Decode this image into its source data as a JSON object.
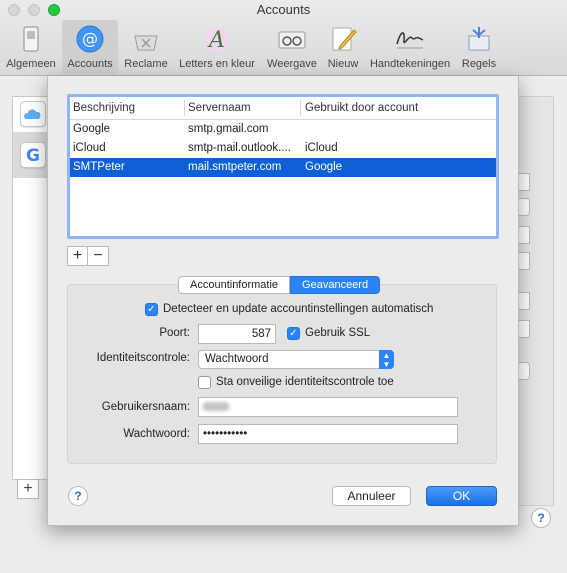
{
  "window": {
    "title": "Accounts"
  },
  "toolbar": {
    "items": [
      {
        "label": "Algemeen",
        "icon": "switch-icon"
      },
      {
        "label": "Accounts",
        "icon": "at-icon"
      },
      {
        "label": "Reclame",
        "icon": "junk-tray-icon"
      },
      {
        "label": "Letters en kleur",
        "icon": "font-color-icon"
      },
      {
        "label": "Weergave",
        "icon": "glasses-icon"
      },
      {
        "label": "Nieuw",
        "icon": "pencil-icon"
      },
      {
        "label": "Handtekeningen",
        "icon": "signature-icon"
      },
      {
        "label": "Regels",
        "icon": "rules-icon"
      }
    ],
    "active_index": 1
  },
  "smtp_table": {
    "columns": [
      "Beschrijving",
      "Servernaam",
      "Gebruikt door account"
    ],
    "rows": [
      {
        "description": "Google",
        "server": "smtp.gmail.com",
        "used_by": ""
      },
      {
        "description": "iCloud",
        "server": "smtp-mail.outlook....",
        "used_by": "iCloud"
      },
      {
        "description": "SMTPeter",
        "server": "mail.smtpeter.com",
        "used_by": "Google"
      }
    ],
    "selected_index": 2
  },
  "add_remove": {
    "add": "+",
    "remove": "−"
  },
  "tabs": {
    "items": [
      "Accountinformatie",
      "Geavanceerd"
    ],
    "active_index": 1
  },
  "advanced": {
    "auto_detect": {
      "label": "Detecteer en update accountinstellingen automatisch",
      "checked": true
    },
    "port": {
      "label": "Poort:",
      "value": "587"
    },
    "ssl": {
      "label": "Gebruik SSL",
      "checked": true
    },
    "auth": {
      "label": "Identiteitscontrole:",
      "value": "Wachtwoord"
    },
    "insecure_auth": {
      "label": "Sta onveilige identiteitscontrole toe",
      "checked": false
    },
    "username": {
      "label": "Gebruikersnaam:"
    },
    "password": {
      "label": "Wachtwoord:",
      "value": "•••••••••••"
    }
  },
  "buttons": {
    "help": "?",
    "cancel": "Annuleer",
    "ok": "OK"
  },
  "background": {
    "add": "+",
    "help": "?"
  },
  "colors": {
    "accent": "#2b83f5",
    "selection": "#0f5fd6",
    "focus_ring": "#8fb6f0"
  }
}
